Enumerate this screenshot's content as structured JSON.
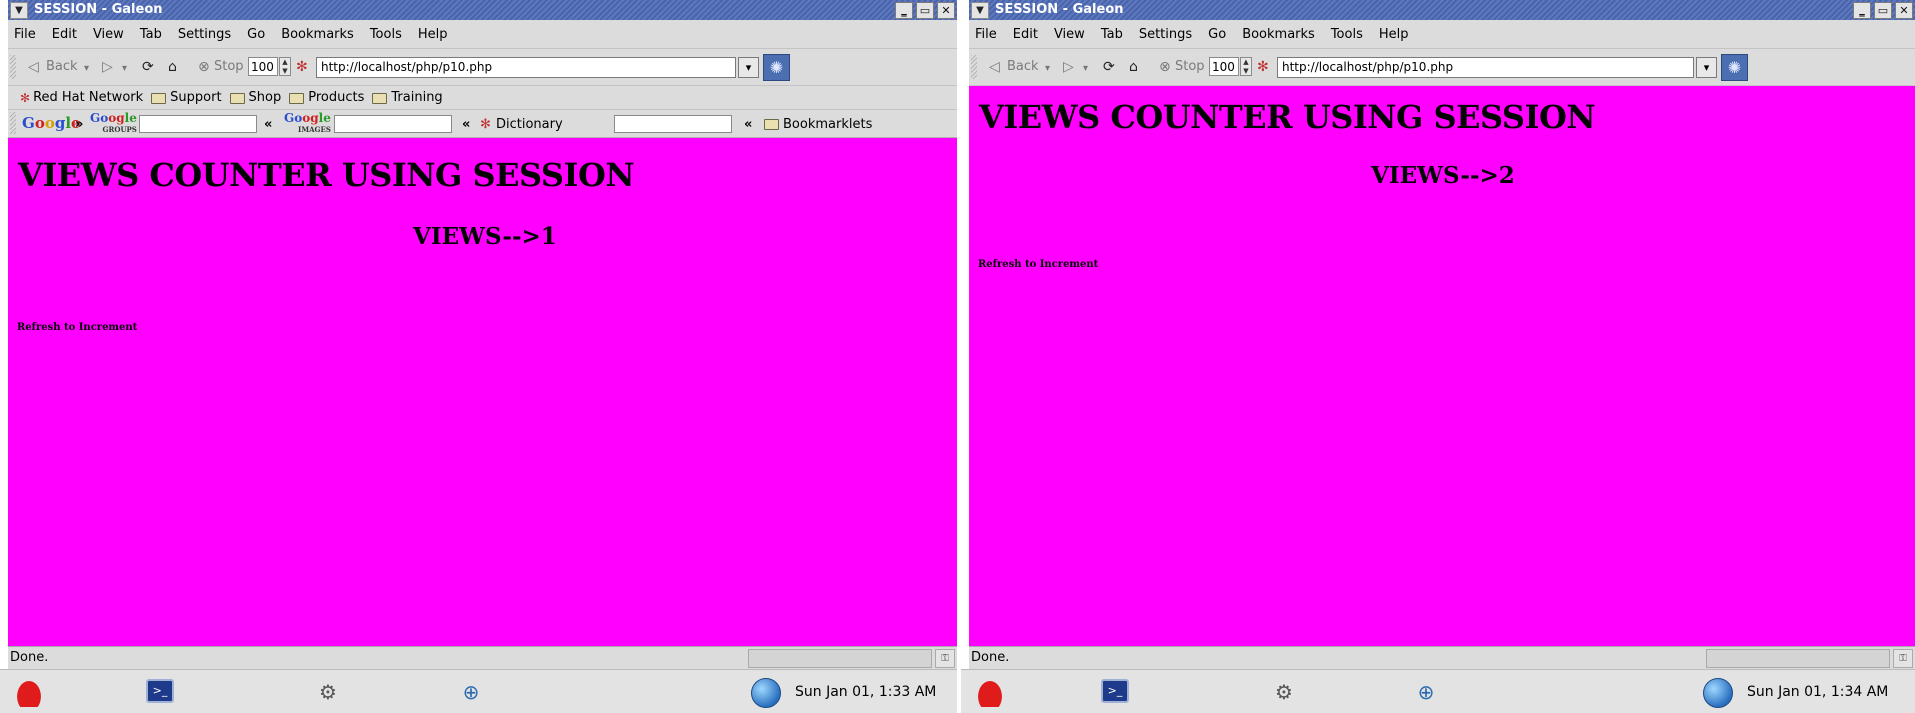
{
  "screens": [
    {
      "window_title": "SESSION - Galeon",
      "menu": [
        "File",
        "Edit",
        "View",
        "Tab",
        "Settings",
        "Go",
        "Bookmarks",
        "Tools",
        "Help"
      ],
      "toolbar": {
        "back_label": "Back",
        "stop_label": "Stop",
        "zoom": "100",
        "url": "http://localhost/php/p10.php"
      },
      "bookmarks": [
        "Red Hat Network",
        "Support",
        "Shop",
        "Products",
        "Training"
      ],
      "search_bar": {
        "separator": "»",
        "back_arrow": "«",
        "dictionary_label": "Dictionary",
        "bookmarklets_label": "Bookmarklets"
      },
      "page": {
        "heading": "VIEWS COUNTER USING SESSION",
        "views": "VIEWS-->1",
        "note": "Refresh to Increment"
      },
      "status": "Done.",
      "clock": "Sun Jan 01,  1:33 AM"
    },
    {
      "window_title": "SESSION - Galeon",
      "menu": [
        "File",
        "Edit",
        "View",
        "Tab",
        "Settings",
        "Go",
        "Bookmarks",
        "Tools",
        "Help"
      ],
      "toolbar": {
        "back_label": "Back",
        "stop_label": "Stop",
        "zoom": "100",
        "url": "http://localhost/php/p10.php"
      },
      "page": {
        "heading": "VIEWS COUNTER USING SESSION",
        "views": "VIEWS-->2",
        "note": "Refresh to Increment"
      },
      "status": "Done.",
      "clock": "Sun Jan 01,  1:34 AM"
    }
  ],
  "icons": [
    "window-menu-icon",
    "minimize-icon",
    "maximize-icon",
    "close-icon",
    "back-arrow-icon",
    "forward-arrow-icon",
    "reload-icon",
    "home-icon",
    "stop-icon",
    "bookmark-star-icon",
    "folder-icon",
    "throbber-icon",
    "red-hat-icon",
    "terminal-icon",
    "settings-icon",
    "network-icon",
    "globe-icon"
  ],
  "colors": {
    "page_background": "#ff00ff",
    "titlebar": "#4a64ac",
    "chrome": "#dcdcdc"
  }
}
